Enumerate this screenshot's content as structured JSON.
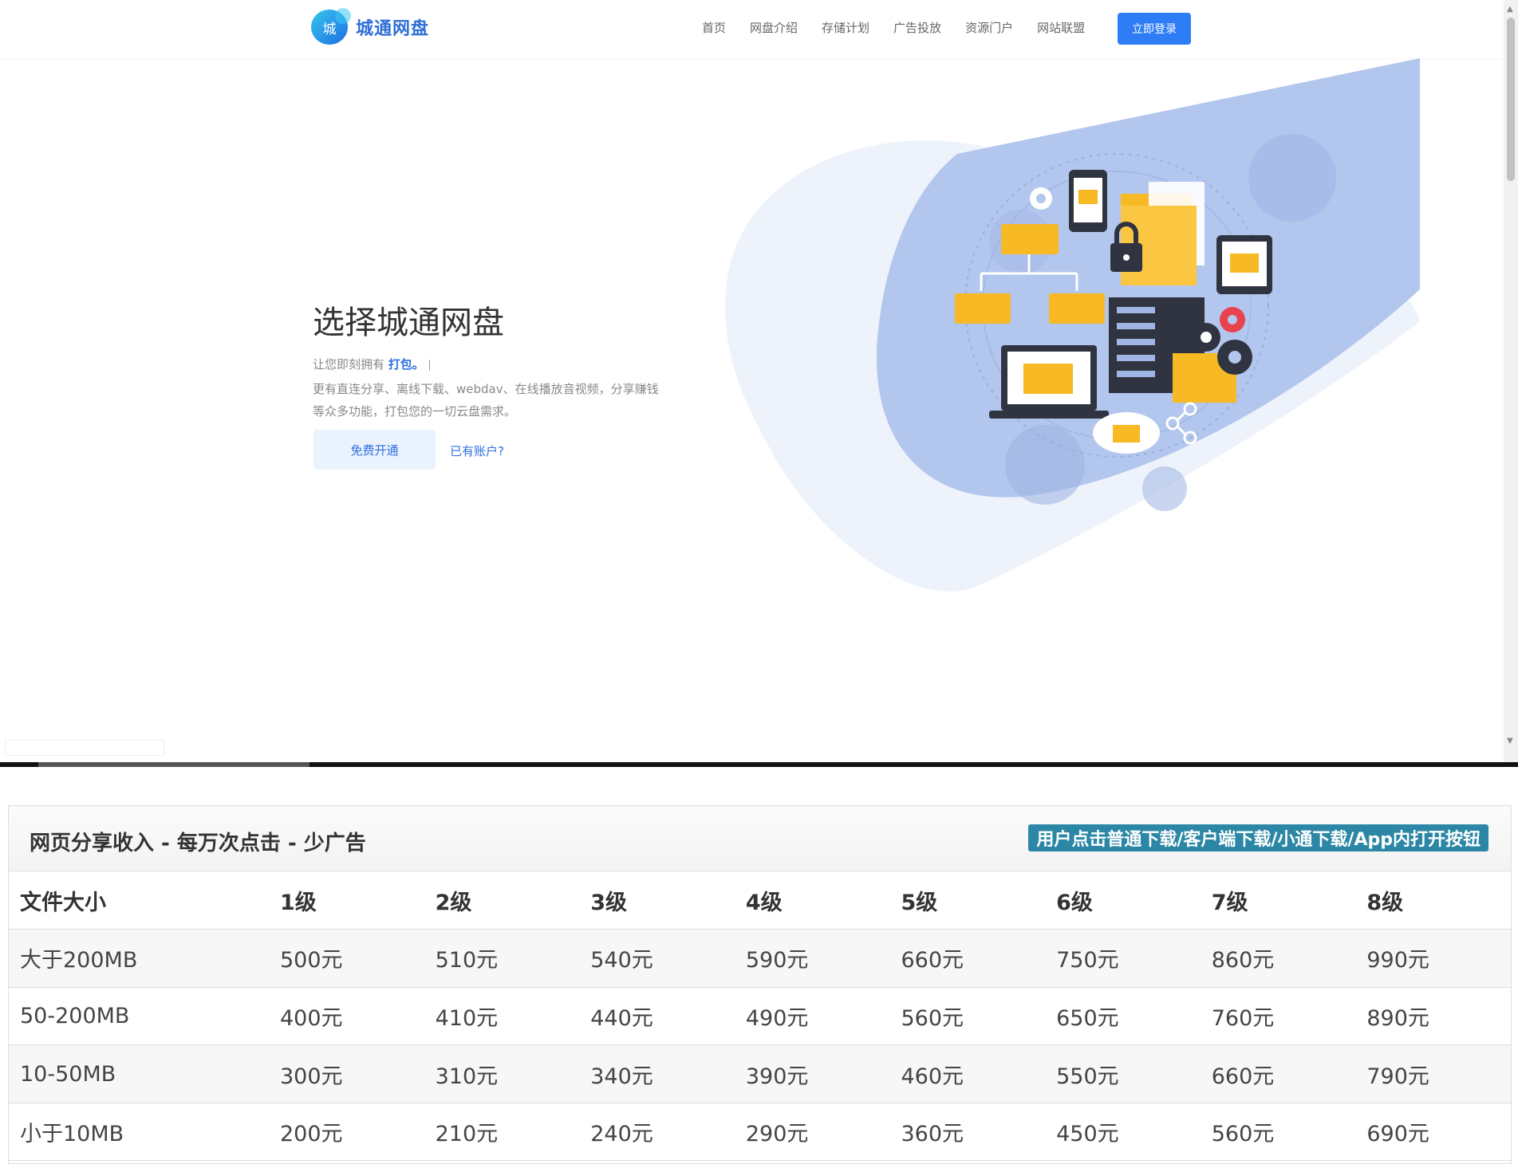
{
  "brand": {
    "logo_glyph": "城",
    "name": "城通网盘"
  },
  "nav": {
    "items": [
      "首页",
      "网盘介绍",
      "存储计划",
      "广告投放",
      "资源门户",
      "网站联盟"
    ],
    "login_label": "立即登录"
  },
  "hero": {
    "title": "选择城通网盘",
    "line1_prefix": "让您即刻拥有",
    "line1_highlight": "打包。",
    "line2": "更有直连分享、离线下载、webdav、在线播放音视频，分享赚钱等众多功能，打包您的一切云盘需求。",
    "free_button": "免费开通",
    "has_account": "已有账户?"
  },
  "pricing": {
    "title": "网页分享收入 - 每万次点击 - 少广告",
    "tag": "用户点击普通下载/客户端下载/小通下载/App内打开按钮",
    "headers": [
      "文件大小",
      "1级",
      "2级",
      "3级",
      "4级",
      "5级",
      "6级",
      "7级",
      "8级"
    ],
    "rows": [
      [
        "大于200MB",
        "500元",
        "510元",
        "540元",
        "590元",
        "660元",
        "750元",
        "860元",
        "990元"
      ],
      [
        "50-200MB",
        "400元",
        "410元",
        "440元",
        "490元",
        "560元",
        "650元",
        "760元",
        "890元"
      ],
      [
        "10-50MB",
        "300元",
        "310元",
        "340元",
        "390元",
        "460元",
        "550元",
        "660元",
        "790元"
      ],
      [
        "小于10MB",
        "200元",
        "210元",
        "240元",
        "290元",
        "360元",
        "450元",
        "560元",
        "690元"
      ]
    ]
  },
  "colors": {
    "accent": "#2e7cf6",
    "tag": "#2b87a5",
    "folder": "#f7b924"
  },
  "icons": [
    "scroll-up-icon",
    "scroll-down-icon",
    "gear-icon",
    "lock-icon",
    "phone-icon",
    "tablet-icon",
    "laptop-icon",
    "server-icon",
    "cloud-icon",
    "share-icon",
    "folder-icon"
  ]
}
